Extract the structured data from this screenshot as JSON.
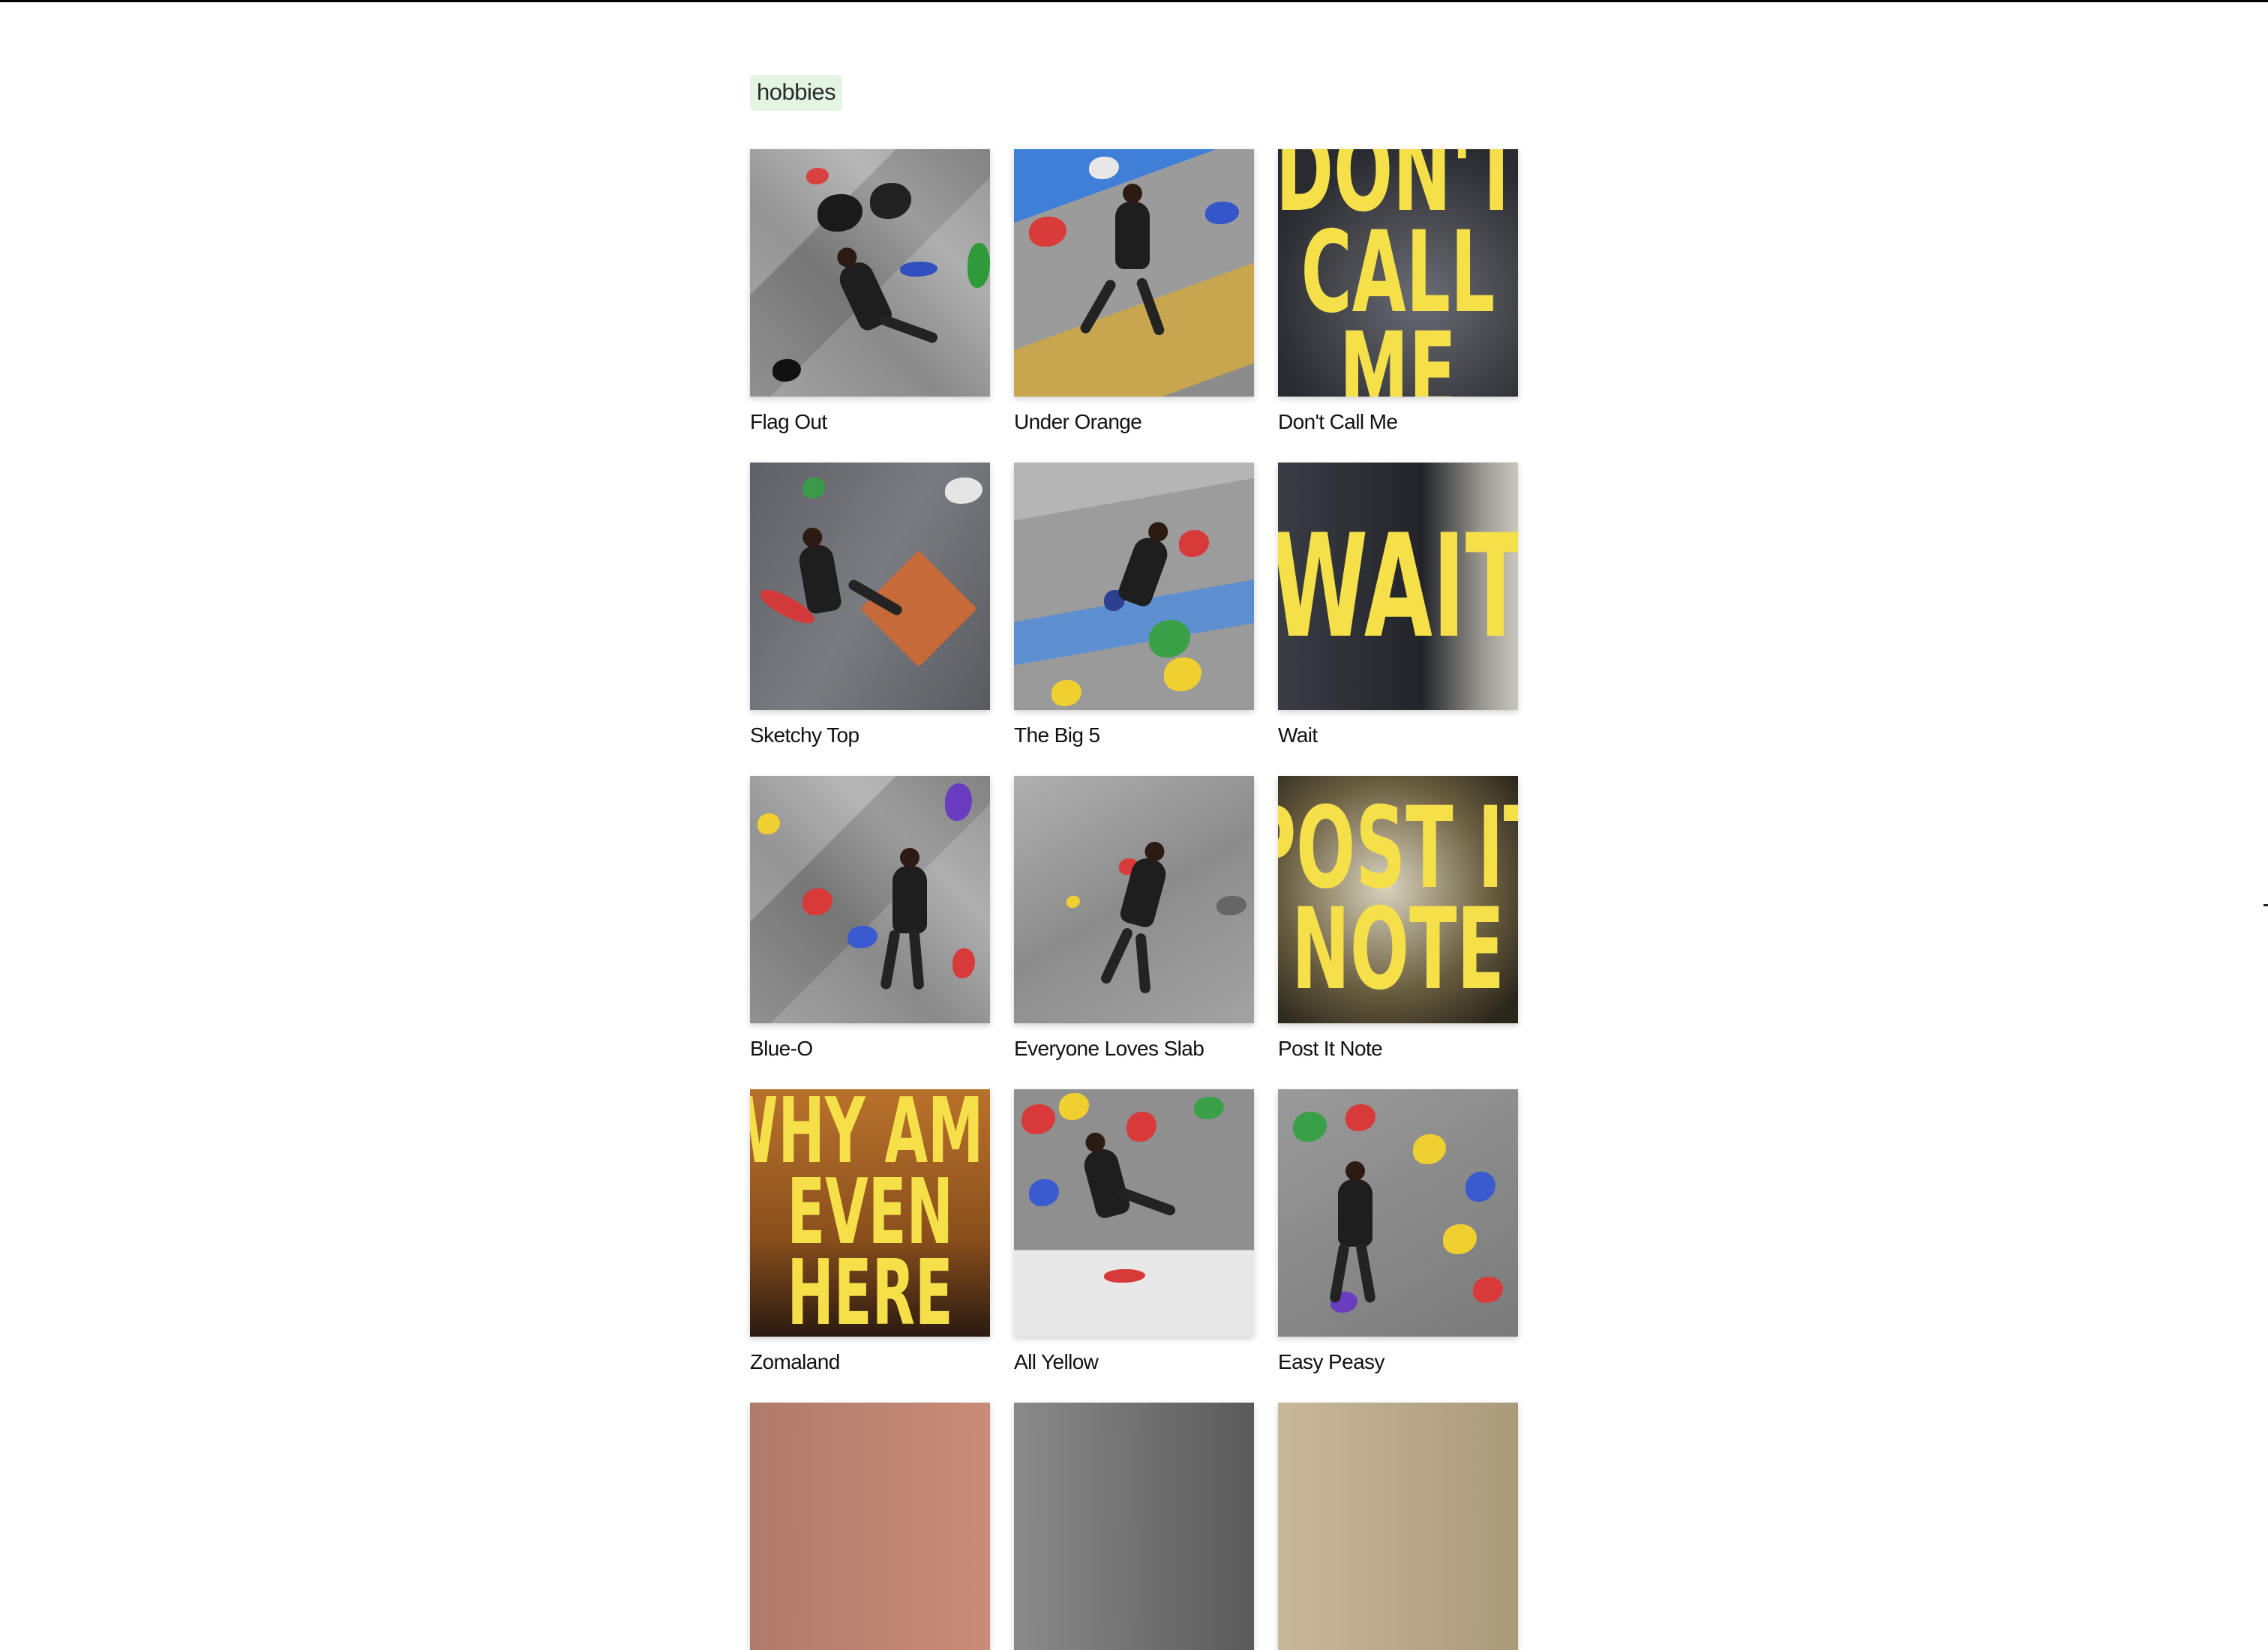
{
  "tag": "hobbies",
  "cards": [
    {
      "title": "Flag Out",
      "kind": "wall"
    },
    {
      "title": "Under Orange",
      "kind": "wall"
    },
    {
      "title": "Don't Call Me",
      "kind": "poster",
      "poster_lines": [
        "DON'T",
        "CALL",
        "ME"
      ]
    },
    {
      "title": "Sketchy Top",
      "kind": "wall"
    },
    {
      "title": "The Big 5",
      "kind": "wall"
    },
    {
      "title": "Wait",
      "kind": "poster",
      "poster_lines": [
        "WAIT"
      ]
    },
    {
      "title": "Blue-O",
      "kind": "wall"
    },
    {
      "title": "Everyone Loves Slab",
      "kind": "wall"
    },
    {
      "title": "Post It Note",
      "kind": "poster",
      "poster_lines": [
        "POST IT",
        "NOTE"
      ]
    },
    {
      "title": "Zomaland",
      "kind": "poster",
      "poster_lines": [
        "WHY AM I",
        "EVEN",
        "HERE"
      ]
    },
    {
      "title": "All Yellow",
      "kind": "wall"
    },
    {
      "title": "Easy Peasy",
      "kind": "wall"
    }
  ],
  "colors": {
    "tag_bg": "#e4f5e4",
    "poster_text": "#f5e04a"
  }
}
